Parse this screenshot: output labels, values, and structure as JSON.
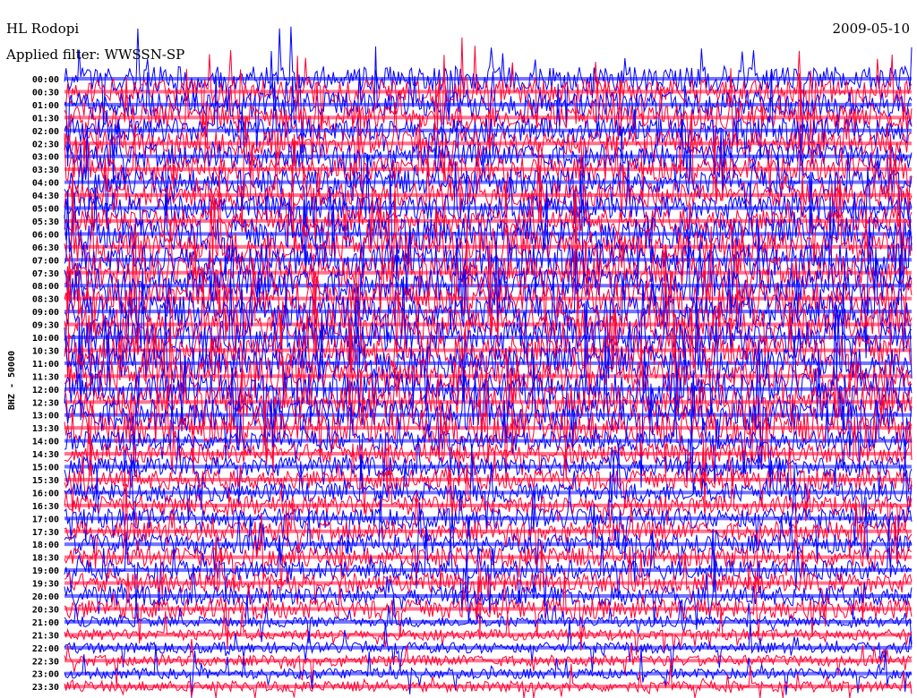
{
  "chart_data": {
    "type": "line",
    "title": "HL Rodopi",
    "subtitle": "Applied filter: WWSSN-SP",
    "date": "2009-05-10",
    "ylabel": "BHZ - 50000",
    "xlabel": "",
    "row_labels": [
      "00:00",
      "00:30",
      "01:00",
      "01:30",
      "02:00",
      "02:30",
      "03:00",
      "03:30",
      "04:00",
      "04:30",
      "05:00",
      "05:30",
      "06:00",
      "06:30",
      "07:00",
      "07:30",
      "08:00",
      "08:30",
      "09:00",
      "09:30",
      "10:00",
      "10:30",
      "11:00",
      "11:30",
      "12:00",
      "12:30",
      "13:00",
      "13:30",
      "14:00",
      "14:30",
      "15:00",
      "15:30",
      "16:00",
      "16:30",
      "17:00",
      "17:30",
      "18:00",
      "18:30",
      "19:00",
      "19:30",
      "20:00",
      "20:30",
      "21:00",
      "21:30",
      "22:00",
      "22:30",
      "23:00",
      "23:30"
    ],
    "colors": [
      "#0000ff",
      "#ff0033"
    ],
    "grid": false,
    "legend": "none"
  }
}
